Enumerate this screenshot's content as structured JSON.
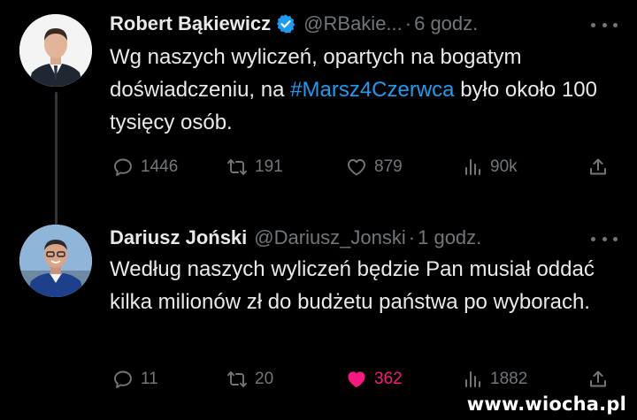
{
  "tweets": [
    {
      "author_name": "Robert Bąkiewicz",
      "verified": true,
      "handle": "@RBakie...",
      "separator": "·",
      "time": "6 godz.",
      "text_before": "Wg naszych wyliczeń, opartych na bogatym doświadczeniu, na ",
      "hashtag": "#Marsz4Czerwca",
      "text_after": " było około 100 tysięcy osób.",
      "stats": {
        "replies": "1446",
        "retweets": "191",
        "likes": "879",
        "views": "90k"
      },
      "liked": false
    },
    {
      "author_name": "Dariusz Joński",
      "verified": false,
      "handle": "@Dariusz_Jonski",
      "separator": "·",
      "time": "1 godz.",
      "text": "Według naszych wyliczeń będzie Pan musiał oddać kilka milionów zł do budżetu państwa po wyborach.",
      "stats": {
        "replies": "11",
        "retweets": "20",
        "likes": "362",
        "views": "1882"
      },
      "liked": true
    }
  ],
  "watermark": "www.wiocha.pl",
  "colors": {
    "background": "#000000",
    "text": "#e7e9ea",
    "secondary": "#71767b",
    "link": "#1d9bf0",
    "like_active": "#f91880",
    "verified_badge": "#1d9bf0"
  },
  "icons": [
    "reply-icon",
    "retweet-icon",
    "like-icon",
    "views-icon",
    "share-icon",
    "more-icon",
    "verified-badge-icon"
  ]
}
